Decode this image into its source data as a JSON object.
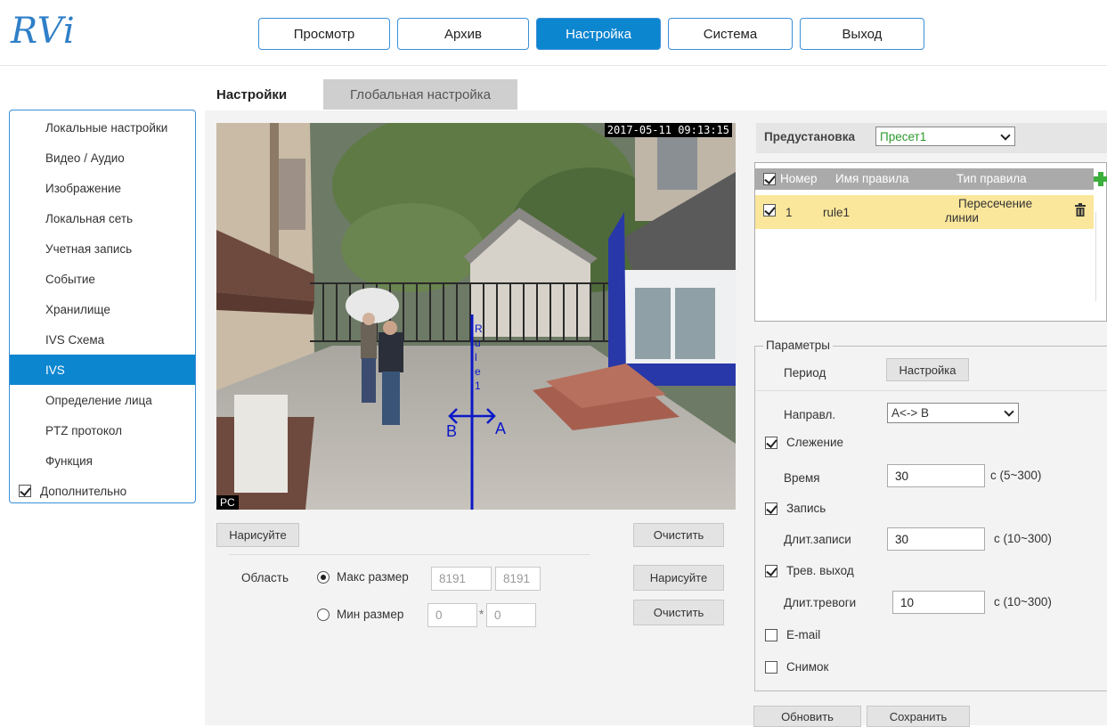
{
  "header": {
    "logo": "RVi",
    "nav": [
      "Просмотр",
      "Архив",
      "Настройка",
      "Система",
      "Выход"
    ],
    "active_nav": "Настройка"
  },
  "tabs": {
    "settings": "Настройки",
    "global": "Глобальная настройка"
  },
  "sidebar": {
    "items": [
      "Локальные настройки",
      "Видео / Аудио",
      "Изображение",
      "Локальная сеть",
      "Учетная запись",
      "Событие",
      "Хранилище",
      "IVS Схема",
      "IVS",
      "Определение лица",
      "PTZ протокол",
      "Функция"
    ],
    "active_item": "IVS",
    "advanced_label": "Дополнительно"
  },
  "video": {
    "timestamp": "2017-05-11 09:13:15",
    "osd": "PC",
    "rule_label": [
      "R",
      "u",
      "l",
      "e",
      "1"
    ],
    "dir_a": "A",
    "dir_b": "B"
  },
  "draw_controls": {
    "draw_label": "Нарисуйте",
    "clear_label": "Очистить",
    "area_label": "Область",
    "max_size_label": "Макс размер",
    "max_w": "8191",
    "max_h": "8191",
    "min_size_label": "Мин размер",
    "min_w": "0",
    "min_h": "0",
    "times": "*",
    "draw2_label": "Нарисуйте",
    "clear2_label": "Очистить"
  },
  "preset": {
    "label": "Предустановка",
    "value": "Пресет1"
  },
  "rules": {
    "columns": [
      "Номер",
      "Имя правила",
      "Тип правила"
    ],
    "rows": [
      {
        "num": "1",
        "name": "rule1",
        "type_line1": "Пересечение",
        "type_line2": "линии"
      }
    ]
  },
  "params": {
    "legend": "Параметры",
    "period_label": "Период",
    "period_button": "Настройка",
    "direction_label": "Направл.",
    "direction_value": "A<-> B",
    "tracking_label": "Слежение",
    "time_label": "Время",
    "time_value": "30",
    "time_range": "с (5~300)",
    "record_label": "Запись",
    "record_dur_label": "Длит.записи",
    "record_dur_value": "30",
    "record_range": "с (10~300)",
    "alarm_label": "Трев. выход",
    "alarm_dur_label": "Длит.тревоги",
    "alarm_dur_value": "10",
    "alarm_range": "с (10~300)",
    "email_label": "E-mail",
    "snapshot_label": "Снимок"
  },
  "footer": {
    "refresh": "Обновить",
    "save": "Сохранить"
  },
  "colors": {
    "accent": "#0d86d0",
    "rule_highlight": "#fbe79b",
    "tripwire": "#0a18c8",
    "add_icon": "#3cae3c"
  }
}
